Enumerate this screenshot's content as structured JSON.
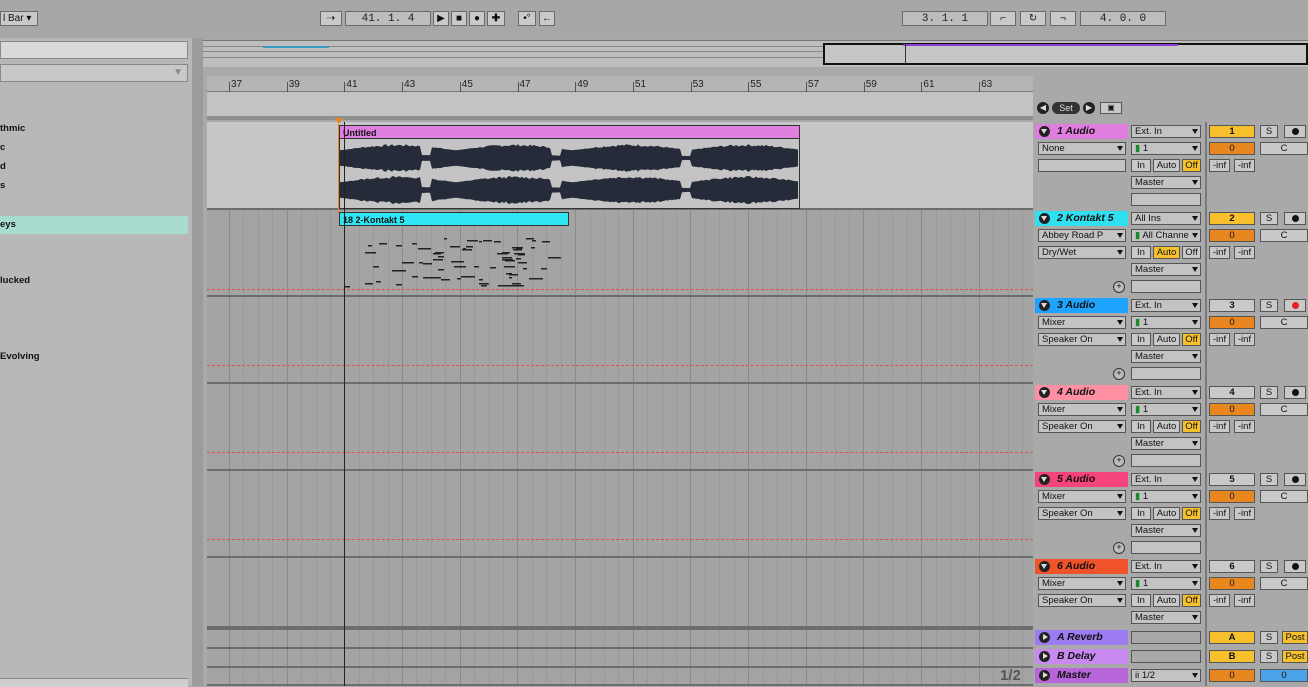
{
  "topbar": {
    "quantize": "l Bar",
    "position": "41.   1.   4",
    "loop_start": "3.   1.   1",
    "loop_length": "4.   0.   0"
  },
  "browser": {
    "items": [
      "thmic",
      "c",
      "d",
      "s",
      "eys",
      "lucked",
      " Evolving"
    ]
  },
  "ruler": {
    "bars": [
      "37",
      "39",
      "41",
      "43",
      "45",
      "47",
      "49",
      "51",
      "53",
      "55",
      "57",
      "59",
      "61",
      "63"
    ]
  },
  "locator": {
    "set_label": "Set"
  },
  "clips": {
    "audio_clip": "Untitled",
    "midi_clip": "18 2-Kontakt 5"
  },
  "tracks": [
    {
      "name": "1 Audio",
      "color": "#e07ee0",
      "input": "Ext. In",
      "channel": "1",
      "device": "None",
      "param": "",
      "out": "Master",
      "num": "1",
      "num_color": "#f6c12d",
      "vol": "0",
      "pan": "C",
      "arm": false
    },
    {
      "name": "2 Kontakt 5",
      "color": "#2fe0f0",
      "input": "All Ins",
      "channel": "All Channe",
      "device": "Abbey Road P",
      "param": "Dry/Wet",
      "out": "Master",
      "num": "2",
      "num_color": "#f6c12d",
      "vol": "0",
      "pan": "C",
      "arm": false
    },
    {
      "name": "3 Audio",
      "color": "#1ea3ff",
      "input": "Ext. In",
      "channel": "1",
      "device": "Mixer",
      "param": "Speaker On",
      "out": "Master",
      "num": "3",
      "num_color": "#c9c9c9",
      "vol": "0",
      "pan": "C",
      "arm": true
    },
    {
      "name": "4 Audio",
      "color": "#ff8fa2",
      "input": "Ext. In",
      "channel": "1",
      "device": "Mixer",
      "param": "Speaker On",
      "out": "Master",
      "num": "4",
      "num_color": "#c9c9c9",
      "vol": "0",
      "pan": "C",
      "arm": false
    },
    {
      "name": "5 Audio",
      "color": "#f5437c",
      "input": "Ext. In",
      "channel": "1",
      "device": "Mixer",
      "param": "Speaker On",
      "out": "Master",
      "num": "5",
      "num_color": "#c9c9c9",
      "vol": "0",
      "pan": "C",
      "arm": false
    },
    {
      "name": "6 Audio",
      "color": "#f0522a",
      "input": "Ext. In",
      "channel": "1",
      "device": "Mixer",
      "param": "Speaker On",
      "out": "Master",
      "num": "6",
      "num_color": "#c9c9c9",
      "vol": "0",
      "pan": "C",
      "arm": false
    }
  ],
  "monitor": {
    "in": "In",
    "auto": "Auto",
    "off": "Off"
  },
  "inf": "-inf",
  "solo_label": "S",
  "returns": [
    {
      "name": "A Reverb",
      "color": "#9d7bf0",
      "num": "A",
      "solo": "S",
      "post": "Post"
    },
    {
      "name": "B Delay",
      "color": "#c889f0",
      "num": "B",
      "solo": "S",
      "post": "Post"
    }
  ],
  "master": {
    "name": "Master",
    "color": "#b765d8",
    "cue": "1/2",
    "vol": "0",
    "pan": "0",
    "page": "1/2"
  }
}
